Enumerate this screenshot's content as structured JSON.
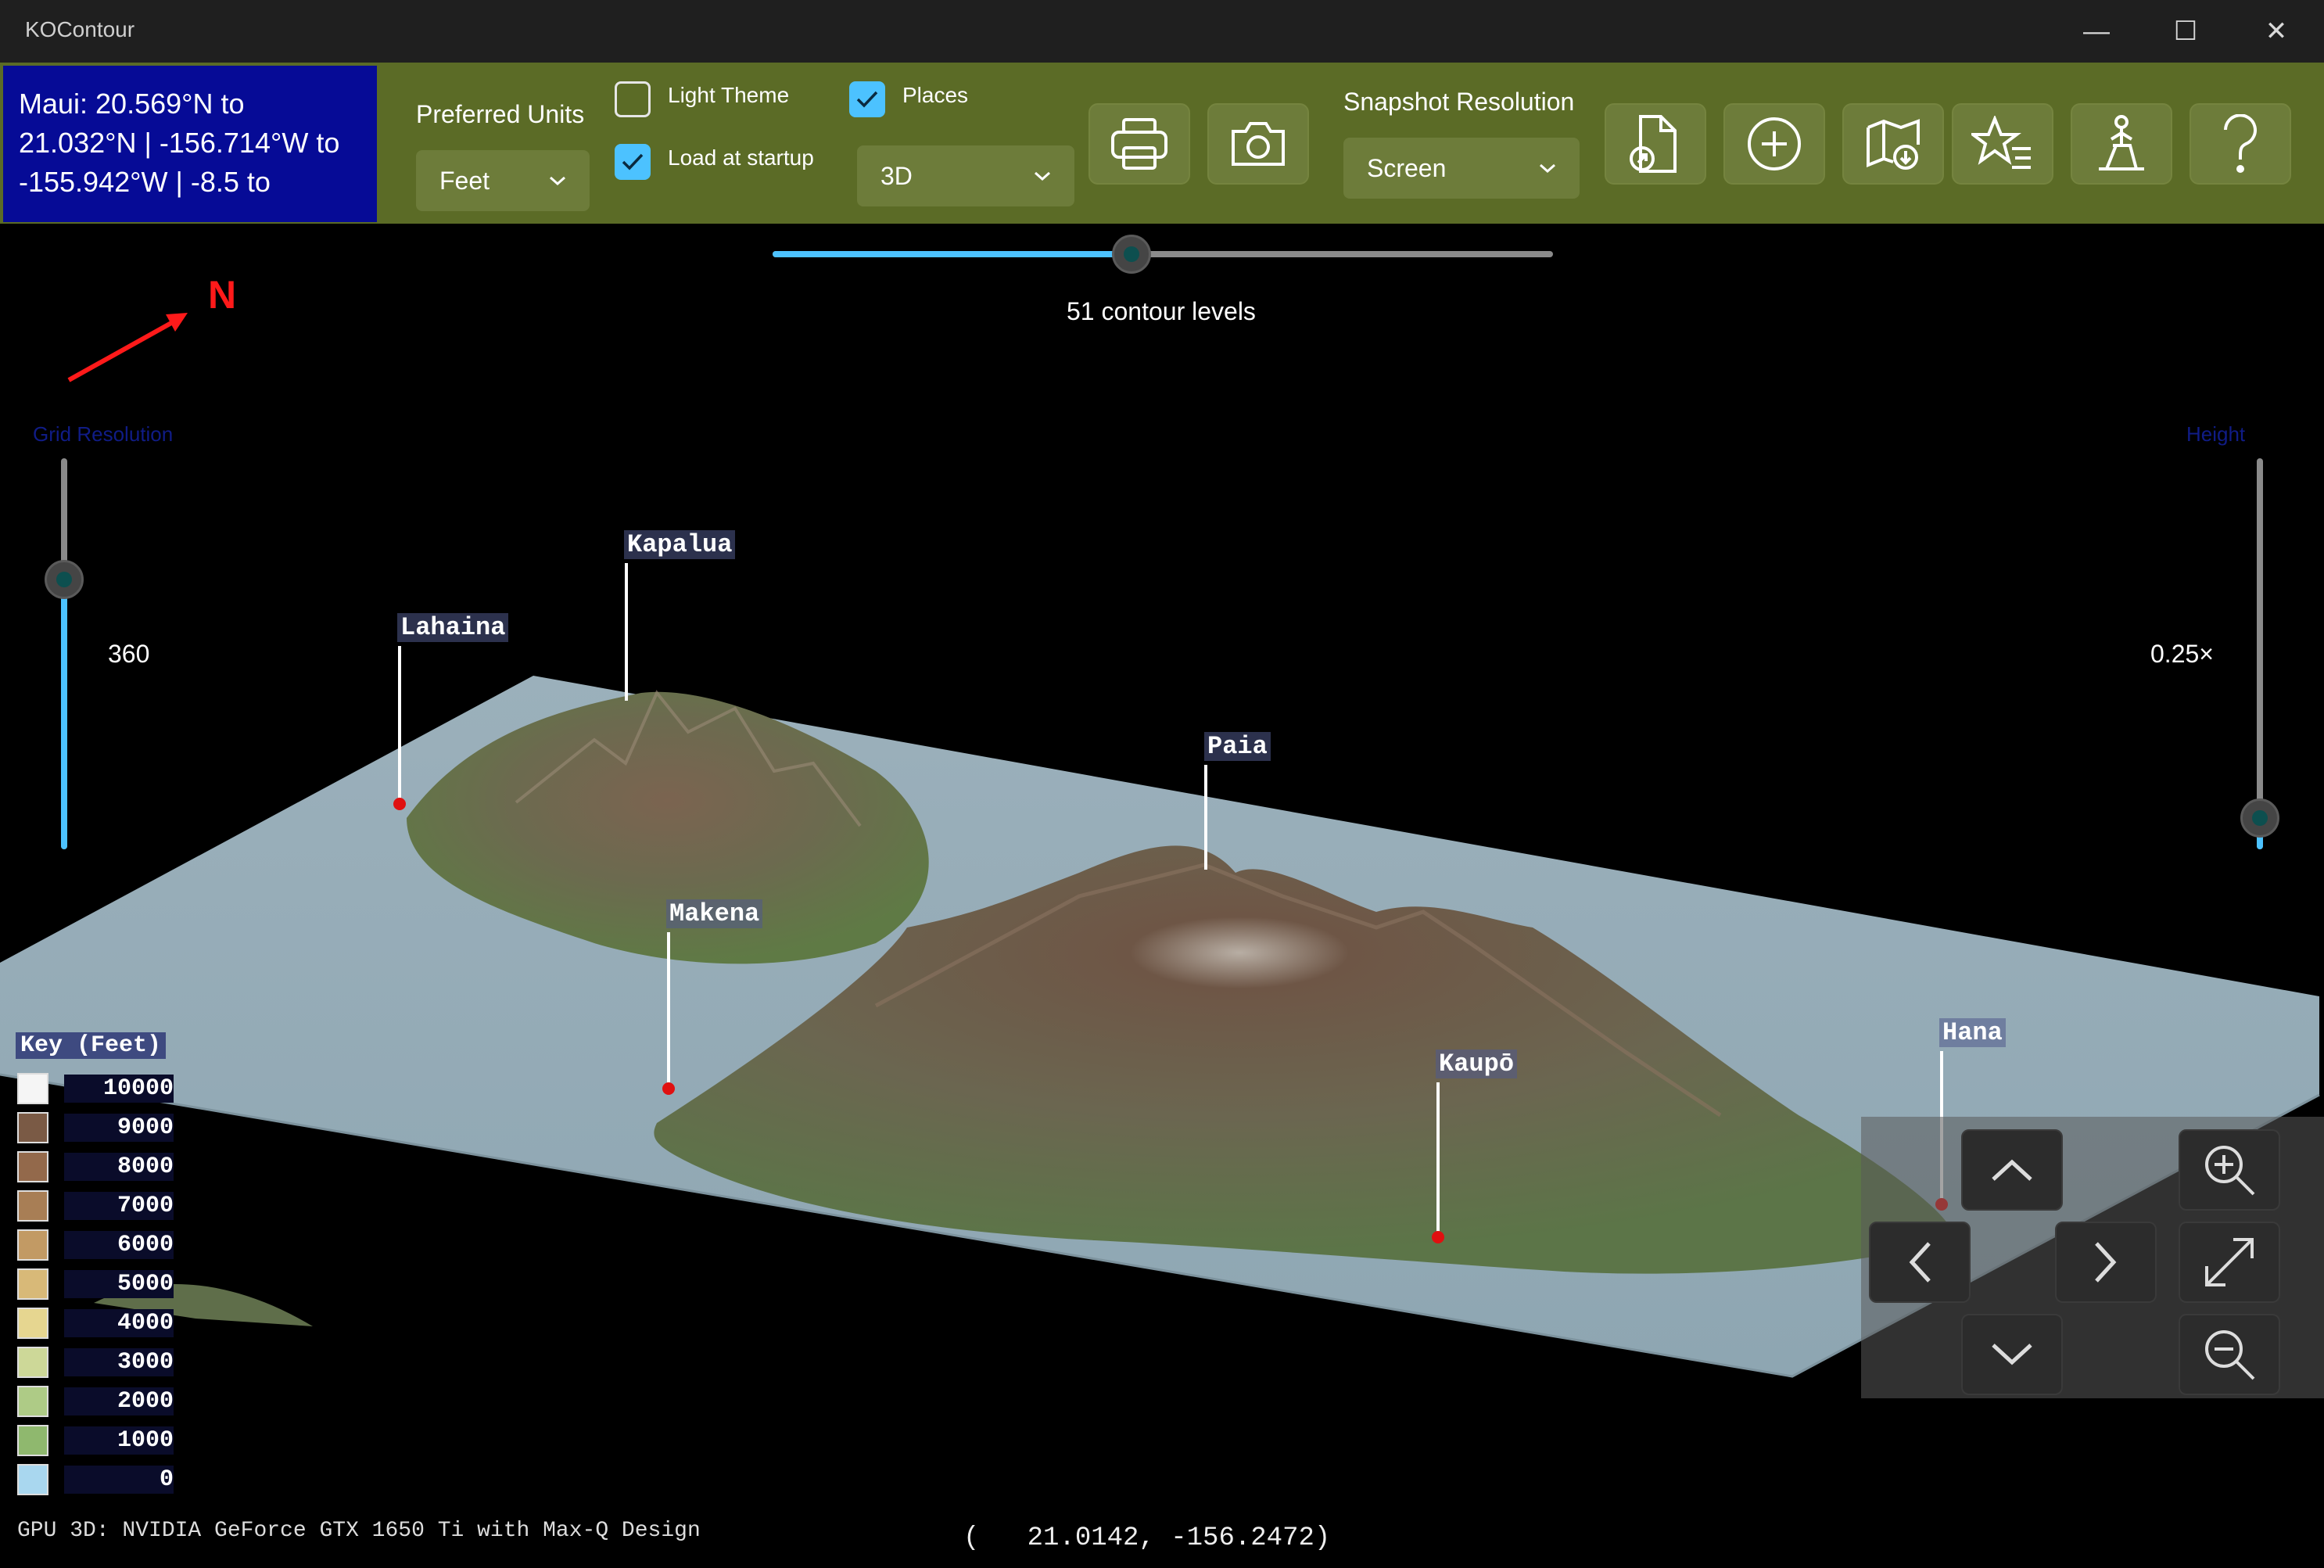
{
  "window": {
    "title": "KOContour",
    "minimize": "—",
    "maximize": "☐",
    "close": "✕"
  },
  "info": {
    "text_line1": "Maui:  20.569°N to",
    "text_line2": "21.032°N | -156.714°W to",
    "text_line3": "-155.942°W | -8.5 to"
  },
  "toolbar": {
    "units_label": "Preferred Units",
    "units_value": "Feet",
    "light_theme_label": "Light Theme",
    "light_theme_checked": false,
    "load_startup_label": "Load at startup",
    "load_startup_checked": true,
    "places_label": "Places",
    "places_checked": true,
    "view_mode_value": "3D",
    "snapshot_label": "Snapshot Resolution",
    "snapshot_value": "Screen",
    "buttons": [
      "print-icon",
      "camera-icon",
      "open-file-icon",
      "add-icon",
      "map-download-icon",
      "favorites-icon",
      "hiker-icon",
      "help-icon"
    ]
  },
  "contour": {
    "label": "51 contour levels",
    "fraction": 0.46
  },
  "compass": {
    "label": "N",
    "color": "#ff1a1a"
  },
  "grid_resolution": {
    "label": "Grid Resolution",
    "value": "360",
    "fraction": 0.69
  },
  "height": {
    "label": "Height",
    "value": "0.25×",
    "fraction": 0.08
  },
  "places": [
    {
      "name": "Lahaina"
    },
    {
      "name": "Kapalua"
    },
    {
      "name": "Paia"
    },
    {
      "name": "Makena"
    },
    {
      "name": "Kaupō"
    },
    {
      "name": "Hana"
    }
  ],
  "key": {
    "title": "Key (Feet)",
    "rows": [
      {
        "value": "10000",
        "color": "#f5f5f5"
      },
      {
        "value": "9000",
        "color": "#7a5a45"
      },
      {
        "value": "8000",
        "color": "#93694b"
      },
      {
        "value": "7000",
        "color": "#a87e55"
      },
      {
        "value": "6000",
        "color": "#c29a64"
      },
      {
        "value": "5000",
        "color": "#d8b978"
      },
      {
        "value": "4000",
        "color": "#e6d690"
      },
      {
        "value": "3000",
        "color": "#cdd898"
      },
      {
        "value": "2000",
        "color": "#aecb86"
      },
      {
        "value": "1000",
        "color": "#8fb86e"
      },
      {
        "value": "0",
        "color": "#a9d7ef"
      }
    ]
  },
  "status": {
    "gpu": "GPU 3D: NVIDIA GeForce GTX 1650 Ti with Max-Q Design",
    "coords": "(   21.0142, -156.2472)"
  },
  "navigation": [
    "pan-up-icon",
    "pan-left-icon",
    "pan-right-icon",
    "pan-down-icon",
    "zoom-in-icon",
    "fit-view-icon",
    "zoom-out-icon"
  ],
  "colors": {
    "toolbar": "#5b6b26",
    "info_bg": "#060b96",
    "accent": "#4cc2ff"
  }
}
